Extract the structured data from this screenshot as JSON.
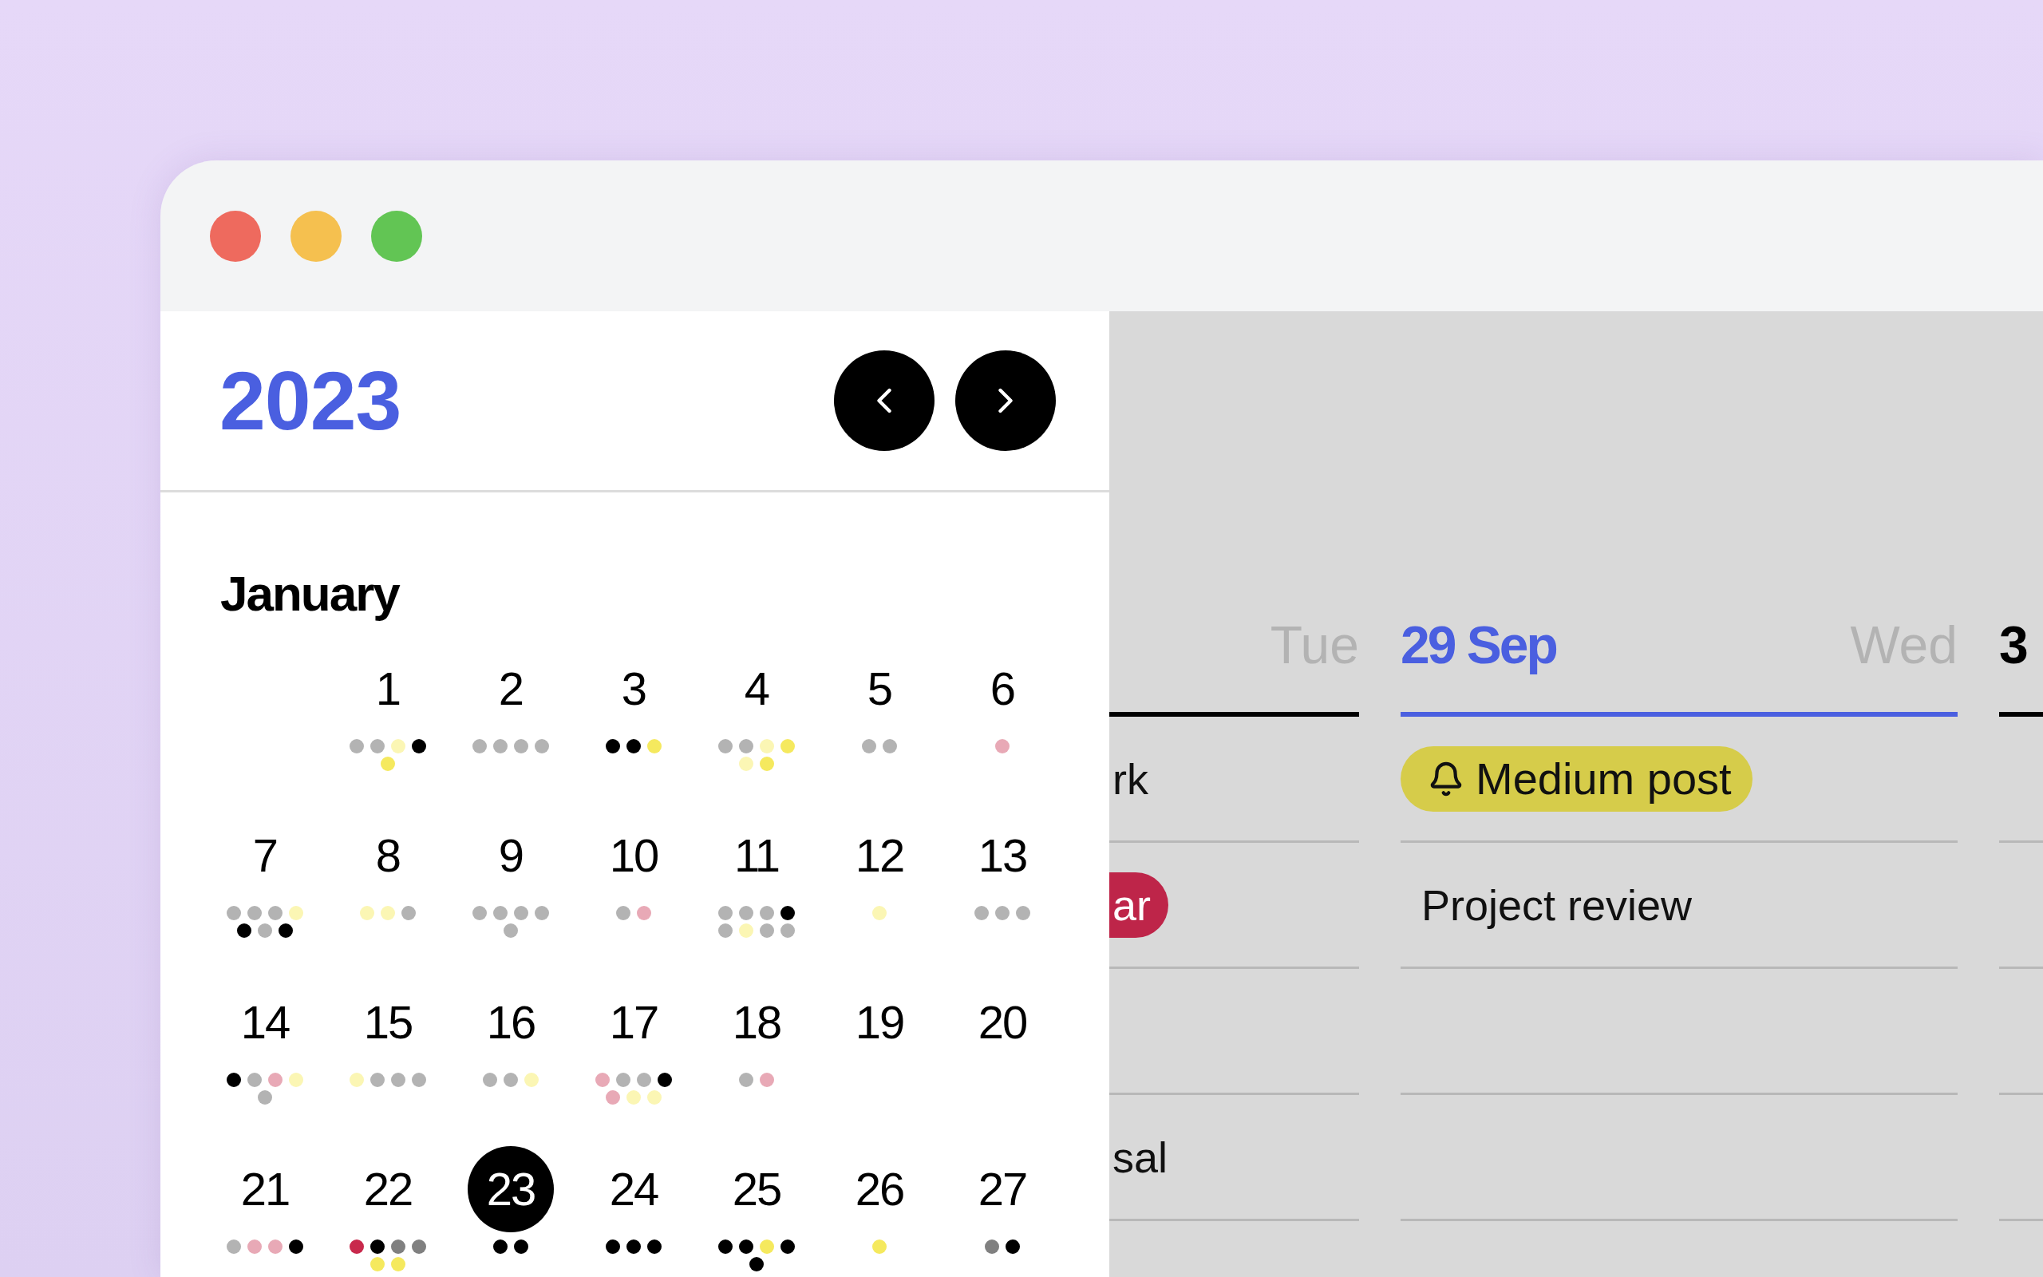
{
  "window": {
    "controls": [
      {
        "color": "#ee6a5e"
      },
      {
        "color": "#f5c04f"
      },
      {
        "color": "#62c554"
      }
    ]
  },
  "year_panel": {
    "year": "2023",
    "nav": [
      {
        "kind": "prev"
      },
      {
        "kind": "next"
      }
    ],
    "month": "January",
    "days": [
      {
        "kind": "blank"
      },
      {
        "kind": "day",
        "label": "1",
        "selected": false,
        "dots": [
          {
            "color": "#b3b3b3"
          },
          {
            "color": "#b3b3b3"
          },
          {
            "color": "#fbf6b4"
          },
          {
            "color": "#000000"
          },
          {
            "color": "#f5e95e"
          }
        ]
      },
      {
        "kind": "day",
        "label": "2",
        "selected": false,
        "dots": [
          {
            "color": "#b3b3b3"
          },
          {
            "color": "#b3b3b3"
          },
          {
            "color": "#b3b3b3"
          },
          {
            "color": "#b3b3b3"
          }
        ]
      },
      {
        "kind": "day",
        "label": "3",
        "selected": false,
        "dots": [
          {
            "color": "#000000"
          },
          {
            "color": "#000000"
          },
          {
            "color": "#f5e95e"
          }
        ]
      },
      {
        "kind": "day",
        "label": "4",
        "selected": false,
        "dots": [
          {
            "color": "#b3b3b3"
          },
          {
            "color": "#b3b3b3"
          },
          {
            "color": "#fbf6b4"
          },
          {
            "color": "#f5e95e"
          },
          {
            "color": "#fbf6b4"
          },
          {
            "color": "#f5e95e"
          }
        ]
      },
      {
        "kind": "day",
        "label": "5",
        "selected": false,
        "dots": [
          {
            "color": "#b3b3b3"
          },
          {
            "color": "#b3b3b3"
          }
        ]
      },
      {
        "kind": "day",
        "label": "6",
        "selected": false,
        "dots": [
          {
            "color": "#e8a9b6"
          }
        ]
      },
      {
        "kind": "day",
        "label": "7",
        "selected": false,
        "dots": [
          {
            "color": "#b3b3b3"
          },
          {
            "color": "#b3b3b3"
          },
          {
            "color": "#b3b3b3"
          },
          {
            "color": "#fbf6b4"
          },
          {
            "color": "#000000"
          },
          {
            "color": "#b3b3b3"
          },
          {
            "color": "#000000"
          }
        ]
      },
      {
        "kind": "day",
        "label": "8",
        "selected": false,
        "dots": [
          {
            "color": "#fbf6b4"
          },
          {
            "color": "#fbf6b4"
          },
          {
            "color": "#b3b3b3"
          }
        ]
      },
      {
        "kind": "day",
        "label": "9",
        "selected": false,
        "dots": [
          {
            "color": "#b3b3b3"
          },
          {
            "color": "#b3b3b3"
          },
          {
            "color": "#b3b3b3"
          },
          {
            "color": "#b3b3b3"
          },
          {
            "color": "#b3b3b3"
          }
        ]
      },
      {
        "kind": "day",
        "label": "10",
        "selected": false,
        "dots": [
          {
            "color": "#b3b3b3"
          },
          {
            "color": "#e8a9b6"
          }
        ]
      },
      {
        "kind": "day",
        "label": "11",
        "selected": false,
        "dots": [
          {
            "color": "#b3b3b3"
          },
          {
            "color": "#b3b3b3"
          },
          {
            "color": "#b3b3b3"
          },
          {
            "color": "#000000"
          },
          {
            "color": "#b3b3b3"
          },
          {
            "color": "#fbf6b4"
          },
          {
            "color": "#b3b3b3"
          },
          {
            "color": "#b3b3b3"
          }
        ]
      },
      {
        "kind": "day",
        "label": "12",
        "selected": false,
        "dots": [
          {
            "color": "#fbf6b4"
          }
        ]
      },
      {
        "kind": "day",
        "label": "13",
        "selected": false,
        "dots": [
          {
            "color": "#b3b3b3"
          },
          {
            "color": "#b3b3b3"
          },
          {
            "color": "#b3b3b3"
          }
        ]
      },
      {
        "kind": "day",
        "label": "14",
        "selected": false,
        "dots": [
          {
            "color": "#000000"
          },
          {
            "color": "#b3b3b3"
          },
          {
            "color": "#e8a9b6"
          },
          {
            "color": "#fbf6b4"
          },
          {
            "color": "#b3b3b3"
          }
        ]
      },
      {
        "kind": "day",
        "label": "15",
        "selected": false,
        "dots": [
          {
            "color": "#fbf6b4"
          },
          {
            "color": "#b3b3b3"
          },
          {
            "color": "#b3b3b3"
          },
          {
            "color": "#b3b3b3"
          }
        ]
      },
      {
        "kind": "day",
        "label": "16",
        "selected": false,
        "dots": [
          {
            "color": "#b3b3b3"
          },
          {
            "color": "#b3b3b3"
          },
          {
            "color": "#fbf6b4"
          }
        ]
      },
      {
        "kind": "day",
        "label": "17",
        "selected": false,
        "dots": [
          {
            "color": "#e8a9b6"
          },
          {
            "color": "#b3b3b3"
          },
          {
            "color": "#b3b3b3"
          },
          {
            "color": "#000000"
          },
          {
            "color": "#e8a9b6"
          },
          {
            "color": "#fbf6b4"
          },
          {
            "color": "#fbf6b4"
          }
        ]
      },
      {
        "kind": "day",
        "label": "18",
        "selected": false,
        "dots": [
          {
            "color": "#b3b3b3"
          },
          {
            "color": "#e8a9b6"
          }
        ]
      },
      {
        "kind": "day",
        "label": "19",
        "selected": false
      },
      {
        "kind": "day",
        "label": "20",
        "selected": false
      },
      {
        "kind": "day",
        "label": "21",
        "selected": false,
        "dots": [
          {
            "color": "#b3b3b3"
          },
          {
            "color": "#e8a9b6"
          },
          {
            "color": "#e8a9b6"
          },
          {
            "color": "#000000"
          }
        ]
      },
      {
        "kind": "day",
        "label": "22",
        "selected": false,
        "dots": [
          {
            "color": "#c8294c"
          },
          {
            "color": "#000000"
          },
          {
            "color": "#808080"
          },
          {
            "color": "#808080"
          },
          {
            "color": "#f5e95e"
          },
          {
            "color": "#f5e95e"
          }
        ]
      },
      {
        "kind": "day",
        "label": "23",
        "selected": true,
        "dots": [
          {
            "color": "#000000"
          },
          {
            "color": "#000000"
          }
        ]
      },
      {
        "kind": "day",
        "label": "24",
        "selected": false,
        "dots": [
          {
            "color": "#000000"
          },
          {
            "color": "#000000"
          },
          {
            "color": "#000000"
          }
        ]
      },
      {
        "kind": "day",
        "label": "25",
        "selected": false,
        "dots": [
          {
            "color": "#000000"
          },
          {
            "color": "#000000"
          },
          {
            "color": "#f5e95e"
          },
          {
            "color": "#000000"
          },
          {
            "color": "#000000"
          }
        ]
      },
      {
        "kind": "day",
        "label": "26",
        "selected": false,
        "dots": [
          {
            "color": "#f5e95e"
          }
        ]
      },
      {
        "kind": "day",
        "label": "27",
        "selected": false,
        "dots": [
          {
            "color": "#808080"
          },
          {
            "color": "#000000"
          }
        ]
      }
    ]
  },
  "week_columns": [
    {
      "day": "Tue",
      "selected": false,
      "events": [
        {
          "kind": "text",
          "label": "rk"
        },
        {
          "kind": "pill",
          "label": "ar",
          "color": "#be2549"
        },
        {
          "kind": "empty"
        },
        {
          "kind": "text",
          "label": "sal"
        }
      ]
    },
    {
      "date": "29 Sep",
      "day": "Wed",
      "selected": true,
      "events": [
        {
          "kind": "reminder",
          "label": "Medium post"
        },
        {
          "kind": "text",
          "label": "Project review"
        },
        {
          "kind": "empty"
        },
        {
          "kind": "empty"
        }
      ]
    },
    {
      "date": "3",
      "selected": false,
      "events": [
        {
          "kind": "empty"
        },
        {
          "kind": "empty"
        },
        {
          "kind": "empty"
        },
        {
          "kind": "empty"
        }
      ]
    }
  ]
}
